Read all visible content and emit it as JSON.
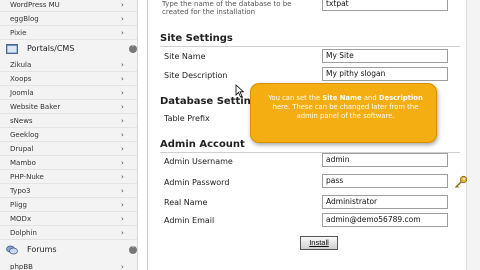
{
  "sidebar": {
    "items_top": [
      {
        "label": "WordPress MU"
      },
      {
        "label": "eggBlog"
      },
      {
        "label": "Pixie"
      }
    ],
    "category_portals": {
      "label": "Portals/CMS"
    },
    "items_portals": [
      {
        "label": "Zikula"
      },
      {
        "label": "Xoops"
      },
      {
        "label": "Joomla"
      },
      {
        "label": "Website Baker"
      },
      {
        "label": "sNews"
      },
      {
        "label": "Geeklog"
      },
      {
        "label": "Drupal"
      },
      {
        "label": "Mambo"
      },
      {
        "label": "PHP-Nuke"
      },
      {
        "label": "Typo3"
      },
      {
        "label": "Pligg"
      },
      {
        "label": "MODx"
      },
      {
        "label": "Dolphin"
      }
    ],
    "category_forums": {
      "label": "Forums"
    },
    "items_forums": [
      {
        "label": "phpBB"
      }
    ]
  },
  "main": {
    "hint": "Type the name of the database to be created for the installation",
    "db_name_value": "txtpat",
    "site_settings": {
      "title": "Site Settings",
      "site_name_label": "Site Name",
      "site_name_value": "My Site",
      "site_desc_label": "Site Description",
      "site_desc_value": "My pithy slogan"
    },
    "database_settings": {
      "title": "Database Settings",
      "table_prefix_label": "Table Prefix"
    },
    "admin_account": {
      "title": "Admin Account",
      "username_label": "Admin Username",
      "username_value": "admin",
      "password_label": "Admin Password",
      "password_value": "pass",
      "realname_label": "Real Name",
      "realname_value": "Administrator",
      "email_label": "Admin Email",
      "email_value": "admin@demo56789.com"
    },
    "install_label": "Install"
  },
  "tooltip": {
    "prefix": "You can set the ",
    "bold1": "Site Name",
    "mid": " and ",
    "bold2": "Description",
    "suffix": " here. These can be changed later from the admin panel of the software."
  },
  "colors": {
    "tooltip_bg": "#f5ae12",
    "sidebar_bg": "#f3f3f3"
  },
  "icons": [
    "chevron-right-icon",
    "collapse-circle-icon",
    "portals-icon",
    "forums-icon",
    "key-icon",
    "cursor-icon"
  ]
}
